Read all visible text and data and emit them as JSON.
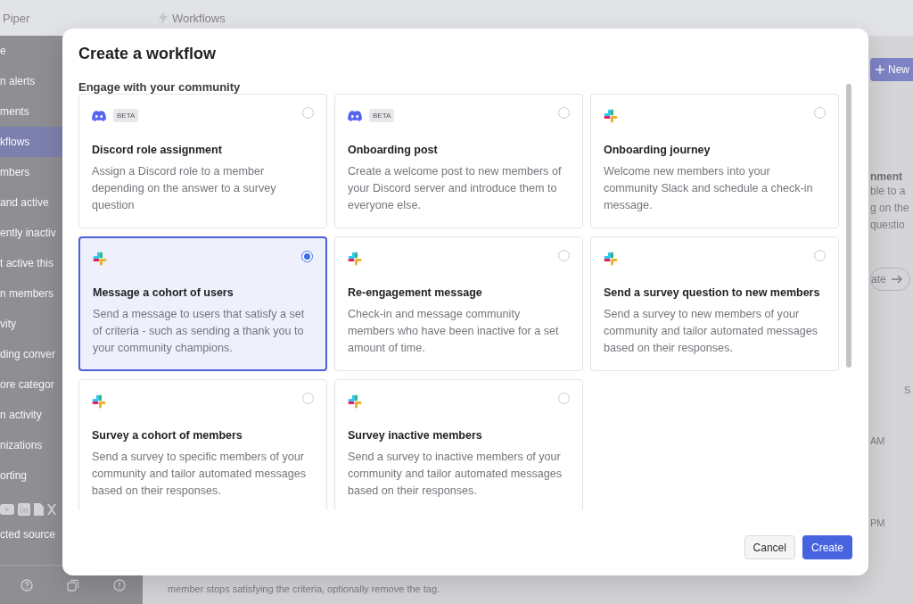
{
  "app": {
    "name": "Piper"
  },
  "header": {
    "title": "Workflows"
  },
  "sidebar": {
    "items": [
      {
        "label": "e",
        "selected": false
      },
      {
        "label": "n alerts",
        "selected": false
      },
      {
        "label": "ments",
        "selected": false
      },
      {
        "label": "kflows",
        "selected": true
      },
      {
        "label": "mbers",
        "selected": false
      },
      {
        "label": "and active",
        "selected": false
      },
      {
        "label": "ently inactiv",
        "selected": false
      },
      {
        "label": "t active this",
        "selected": false
      },
      {
        "label": "n members",
        "selected": false
      },
      {
        "label": "vity",
        "selected": false
      },
      {
        "label": "ding conver",
        "selected": false
      },
      {
        "label": "ore categor",
        "selected": false
      },
      {
        "label": "n activity",
        "selected": false
      },
      {
        "label": "nizations",
        "selected": false
      },
      {
        "label": "orting",
        "selected": false
      }
    ],
    "sources_label": "cted source"
  },
  "background": {
    "new_button": "New",
    "card_title": "nment",
    "card_lines": [
      "ble to a",
      "g on the",
      "questio"
    ],
    "template_button": "ate",
    "column_label": "S",
    "times": [
      "AM",
      "PM"
    ],
    "footer_text": "member stops satisfying the criteria, optionally remove the tag."
  },
  "modal": {
    "title": "Create a workflow",
    "section": "Engage with your community",
    "cards": [
      {
        "kind": "discord",
        "badge": "BETA",
        "title": "Discord role assignment",
        "description": "Assign a Discord role to a member depending on the answer to a survey question",
        "selected": false
      },
      {
        "kind": "discord",
        "badge": "BETA",
        "title": "Onboarding post",
        "description": "Create a welcome post to new members of your Discord server and introduce them to everyone else.",
        "selected": false
      },
      {
        "kind": "slack",
        "title": "Onboarding journey",
        "description": "Welcome new members into your community Slack and schedule a check-in message.",
        "selected": false
      },
      {
        "kind": "slack",
        "title": "Message a cohort of users",
        "description": "Send a message to users that satisfy a set of criteria - such as sending a thank you to your community champions.",
        "selected": true
      },
      {
        "kind": "slack",
        "title": "Re-engagement message",
        "description": "Check-in and message community members who have been inactive for a set amount of time.",
        "selected": false
      },
      {
        "kind": "slack",
        "title": "Send a survey question to new members",
        "description": "Send a survey to new members of your community and tailor automated messages based on their responses.",
        "selected": false
      },
      {
        "kind": "slack",
        "title": "Survey a cohort of members",
        "description": "Send a survey to specific members of your community and tailor automated messages based on their responses.",
        "selected": false
      },
      {
        "kind": "slack",
        "title": "Survey inactive members",
        "description": "Send a survey to inactive members of your community and tailor automated messages based on their responses.",
        "selected": false
      }
    ],
    "buttons": {
      "cancel": "Cancel",
      "create": "Create"
    }
  }
}
